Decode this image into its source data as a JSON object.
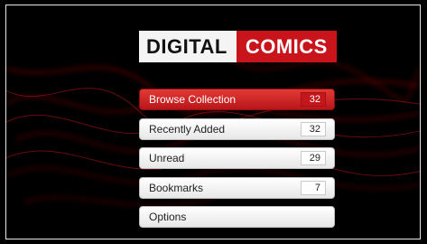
{
  "logo": {
    "part1": "DIGITAL",
    "part2": "COMICS"
  },
  "menu": [
    {
      "label": "Browse Collection",
      "count": "32",
      "active": true
    },
    {
      "label": "Recently Added",
      "count": "32",
      "active": false
    },
    {
      "label": "Unread",
      "count": "29",
      "active": false
    },
    {
      "label": "Bookmarks",
      "count": "7",
      "active": false
    },
    {
      "label": "Options",
      "active": false
    }
  ],
  "colors": {
    "accent": "#c8141a",
    "background": "#000000"
  }
}
